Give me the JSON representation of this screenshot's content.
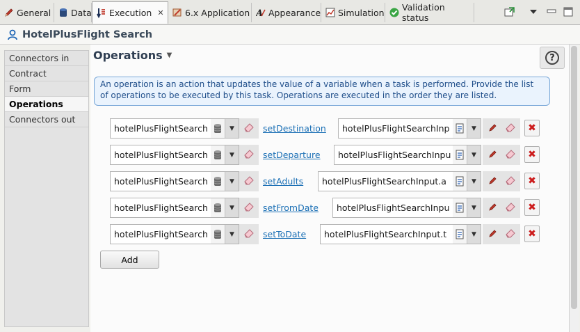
{
  "tabs": [
    {
      "label": "General",
      "icon": "pencil-icon"
    },
    {
      "label": "Data",
      "icon": "database-icon"
    },
    {
      "label": "Execution",
      "icon": "execution-icon",
      "active": true
    },
    {
      "label": "6.x Application",
      "icon": "application-icon"
    },
    {
      "label": "Appearance",
      "icon": "appearance-icon"
    },
    {
      "label": "Simulation",
      "icon": "simulation-icon"
    },
    {
      "label": "Validation status",
      "icon": "check-circle-icon"
    }
  ],
  "header": {
    "title": "HotelPlusFlight Search"
  },
  "nav": [
    {
      "label": "Connectors in"
    },
    {
      "label": "Contract"
    },
    {
      "label": "Form"
    },
    {
      "label": "Operations",
      "selected": true
    },
    {
      "label": "Connectors out"
    }
  ],
  "section": {
    "title": "Operations",
    "description": "An operation is an action that updates the value of a variable when a task is performed.  Provide the list of operations to be executed by this task. Operations are executed in the order they are listed."
  },
  "operations": [
    {
      "target": "hotelPlusFlightSearch",
      "operator": "setDestination",
      "value": "hotelPlusFlightSearchInp"
    },
    {
      "target": "hotelPlusFlightSearch",
      "operator": "setDeparture",
      "value": "hotelPlusFlightSearchInpu"
    },
    {
      "target": "hotelPlusFlightSearch",
      "operator": "setAdults",
      "value": "hotelPlusFlightSearchInput.a"
    },
    {
      "target": "hotelPlusFlightSearch",
      "operator": "setFromDate",
      "value": "hotelPlusFlightSearchInpu"
    },
    {
      "target": "hotelPlusFlightSearch",
      "operator": "setToDate",
      "value": "hotelPlusFlightSearchInput.t"
    }
  ],
  "add_label": "Add",
  "colors": {
    "link": "#1a6fb5",
    "info_border": "#7aa8d8",
    "delete": "#cc1b1b"
  }
}
